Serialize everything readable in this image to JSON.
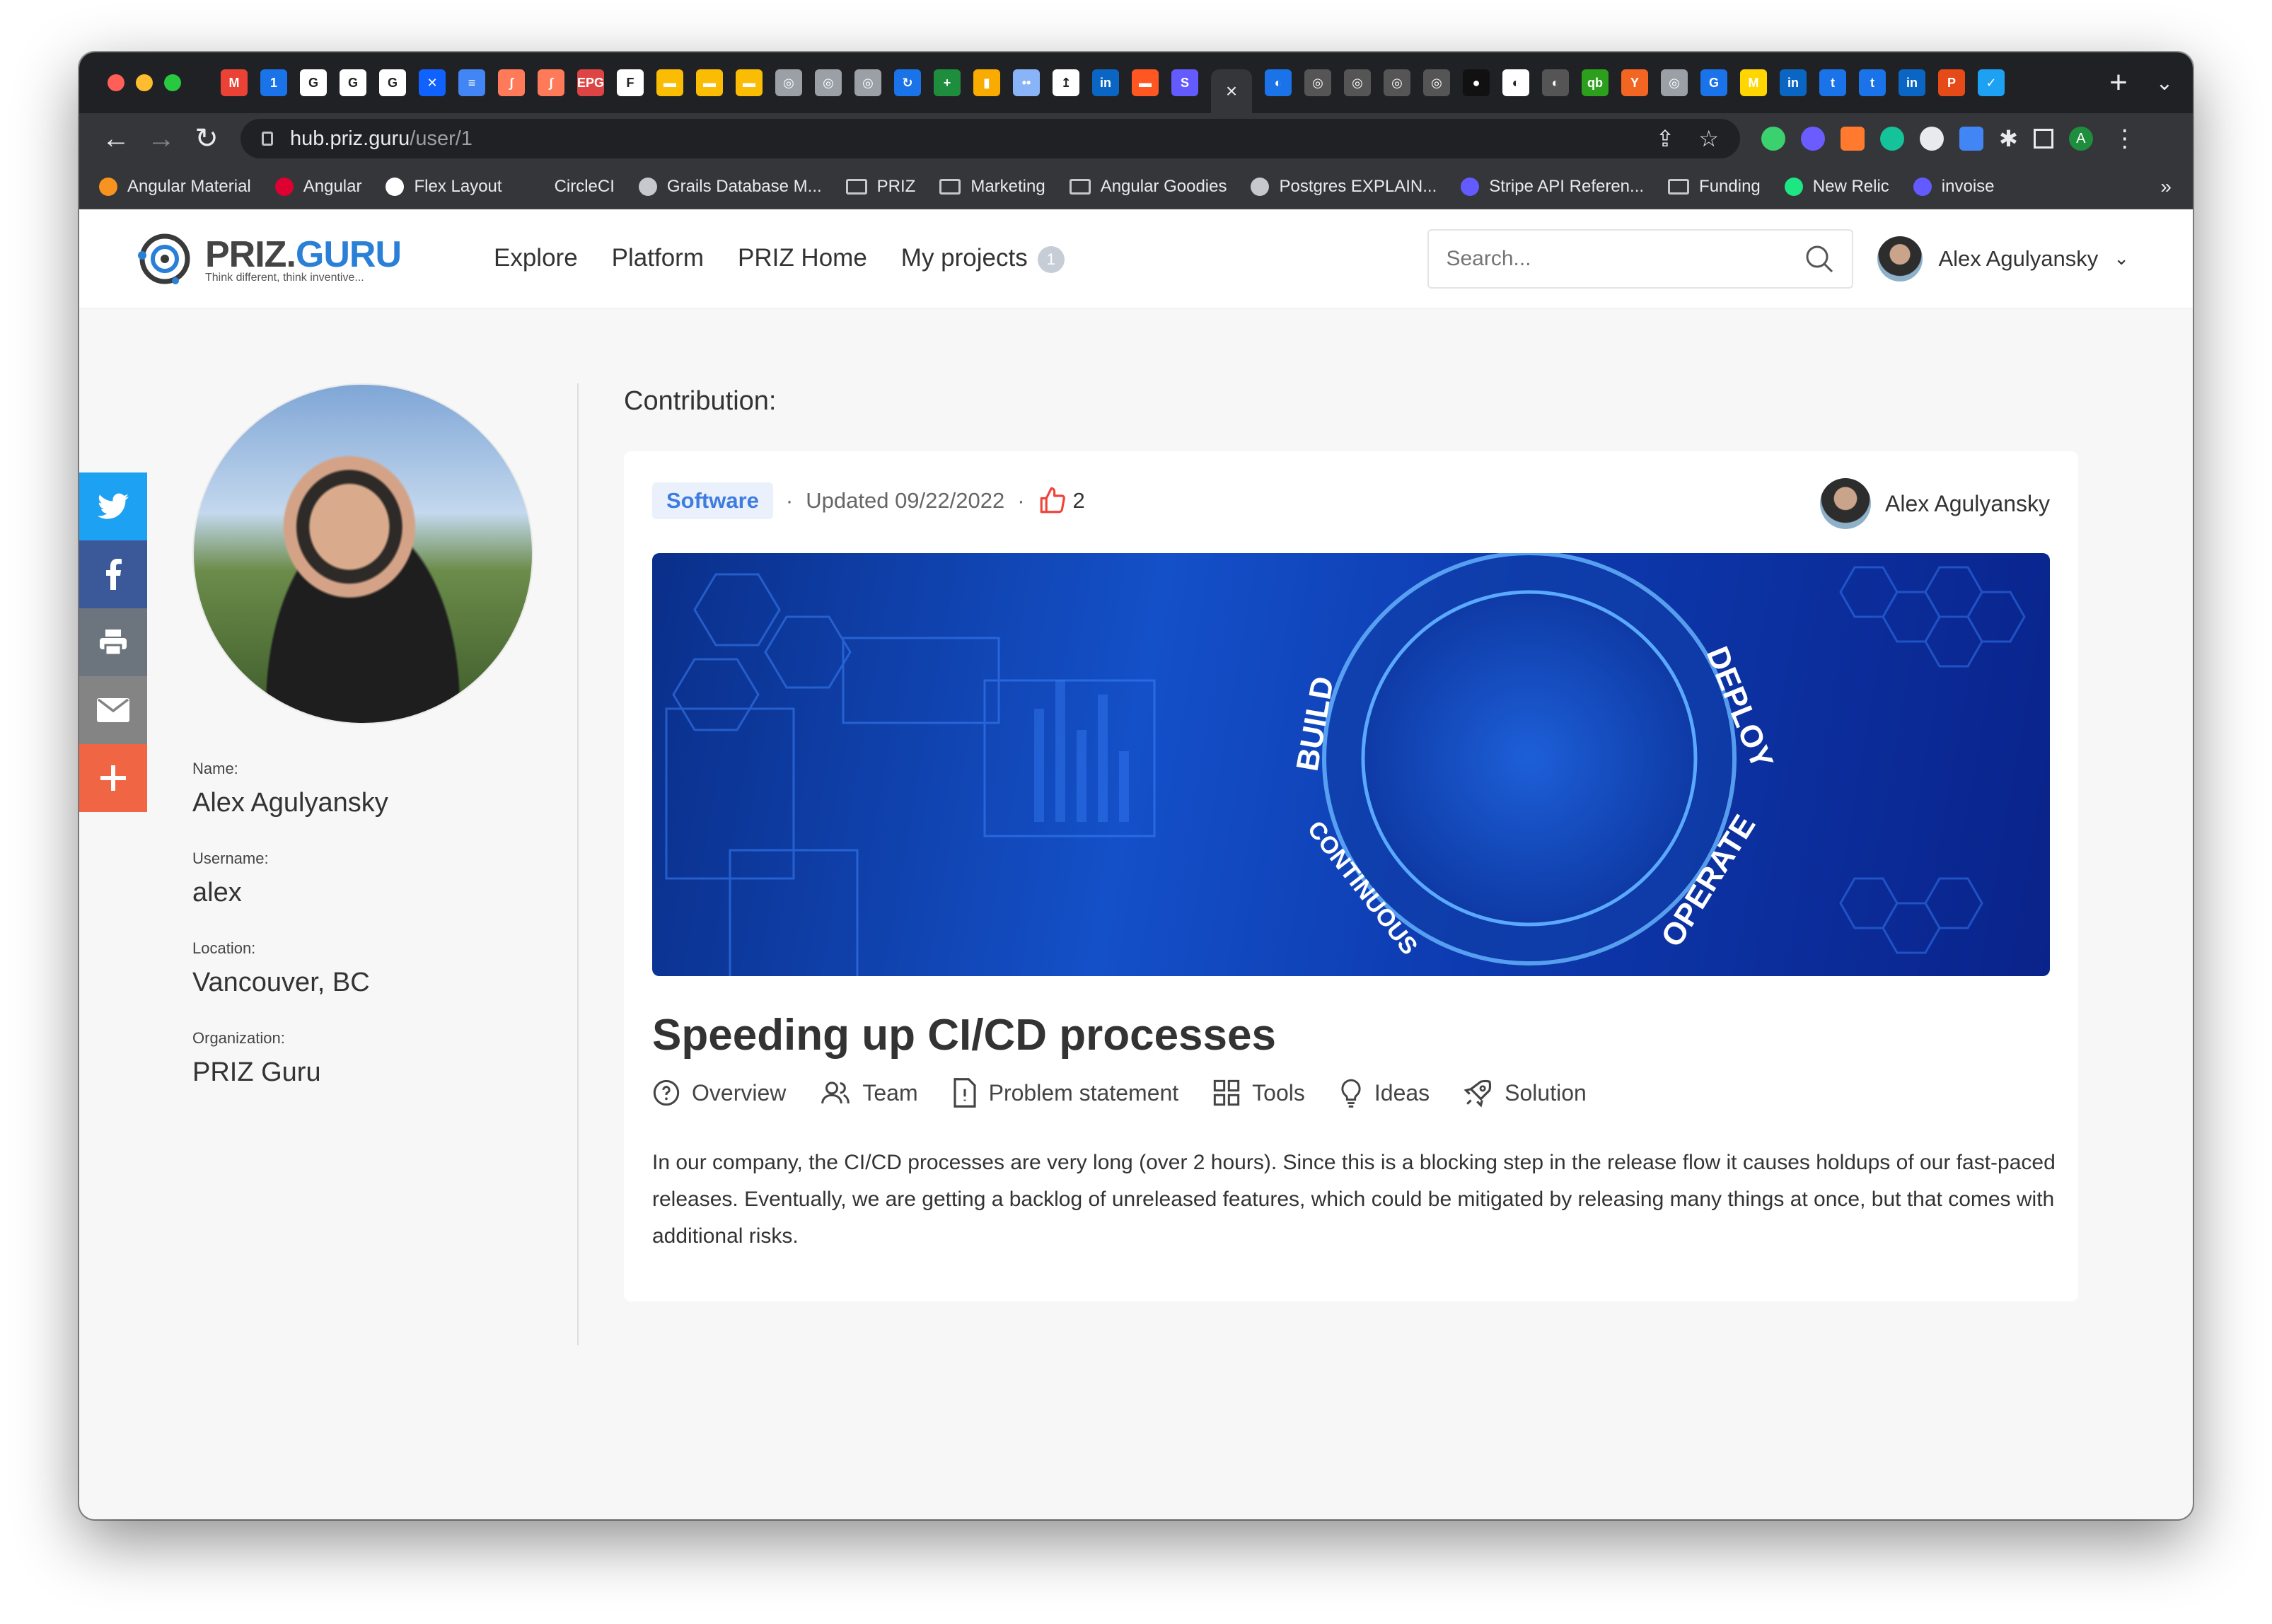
{
  "browser": {
    "url_host": "hub.priz.guru",
    "url_path": "/user/1",
    "tabs": [
      "M",
      "1",
      "G",
      "G",
      "G",
      "✕",
      "≡",
      "∫",
      "∫",
      "EPG",
      "F",
      "▬",
      "▬",
      "▬",
      "◎",
      "◎",
      "◎",
      "↻",
      "+",
      "▮",
      "••",
      "↥",
      "in",
      "▬",
      "S",
      "×",
      "◐",
      "◎",
      "◎",
      "◎",
      "◎",
      "●",
      "◐",
      "◐",
      "qb",
      "Y",
      "◎",
      "G",
      "M",
      "in",
      "t",
      "t",
      "in",
      "P",
      "✓"
    ],
    "bookmarks": [
      {
        "label": "Angular Material",
        "icon": "shield-icon",
        "color": "#f7931e"
      },
      {
        "label": "Angular",
        "icon": "angular-icon",
        "color": "#dd0031"
      },
      {
        "label": "Flex Layout",
        "icon": "github-icon",
        "color": "#ffffff"
      },
      {
        "label": "CircleCI",
        "icon": "circleci-icon",
        "color": "#35363a"
      },
      {
        "label": "Grails Database M...",
        "icon": "globe-icon",
        "color": "#c5c8cc"
      },
      {
        "label": "PRIZ",
        "icon": "folder-icon",
        "color": ""
      },
      {
        "label": "Marketing",
        "icon": "folder-icon",
        "color": ""
      },
      {
        "label": "Angular Goodies",
        "icon": "folder-icon",
        "color": ""
      },
      {
        "label": "Postgres EXPLAIN...",
        "icon": "globe-icon",
        "color": "#c5c8cc"
      },
      {
        "label": "Stripe API Referen...",
        "icon": "stripe-icon",
        "color": "#635bff"
      },
      {
        "label": "Funding",
        "icon": "folder-icon",
        "color": ""
      },
      {
        "label": "New Relic",
        "icon": "newrelic-icon",
        "color": "#1ce783"
      },
      {
        "label": "invoise",
        "icon": "stripe-icon",
        "color": "#635bff"
      }
    ],
    "more": "»"
  },
  "site": {
    "logo_text_a": "PRIZ.",
    "logo_text_b": "GURU",
    "logo_tagline": "Think different, think inventive...",
    "nav": [
      "Explore",
      "Platform",
      "PRIZ Home",
      "My projects"
    ],
    "projects_count": "1",
    "search_placeholder": "Search...",
    "user_name": "Alex Agulyansky",
    "accent": "#2a7fd6"
  },
  "profile": {
    "name_label": "Name:",
    "name": "Alex Agulyansky",
    "username_label": "Username:",
    "username": "alex",
    "location_label": "Location:",
    "location": "Vancouver, BC",
    "organization_label": "Organization:",
    "organization": "PRIZ Guru"
  },
  "social": [
    {
      "name": "twitter",
      "color": "#1da1f2"
    },
    {
      "name": "facebook",
      "color": "#3b5998"
    },
    {
      "name": "print",
      "color": "#6c757d"
    },
    {
      "name": "email",
      "color": "#848484"
    },
    {
      "name": "share",
      "color": "#f06543"
    }
  ],
  "contribution": {
    "heading": "Contribution:",
    "tag": "Software",
    "updated": "Updated 09/22/2022",
    "likes": "2",
    "author": "Alex Agulyansky",
    "title": "Speeding up CI/CD processes",
    "banner_words": [
      "BUILD",
      "DEPLOY",
      "OPERATE",
      "CONTINUOUS"
    ],
    "tabs": [
      "Overview",
      "Team",
      "Problem statement",
      "Tools",
      "Ideas",
      "Solution"
    ],
    "description": "In our company, the CI/CD processes are very long (over 2 hours). Since this is a blocking step in the release flow it causes holdups of our fast-paced releases. Eventually, we are getting a backlog of unreleased features, which could be mitigated by releasing many things at once, but that comes with additional risks."
  }
}
